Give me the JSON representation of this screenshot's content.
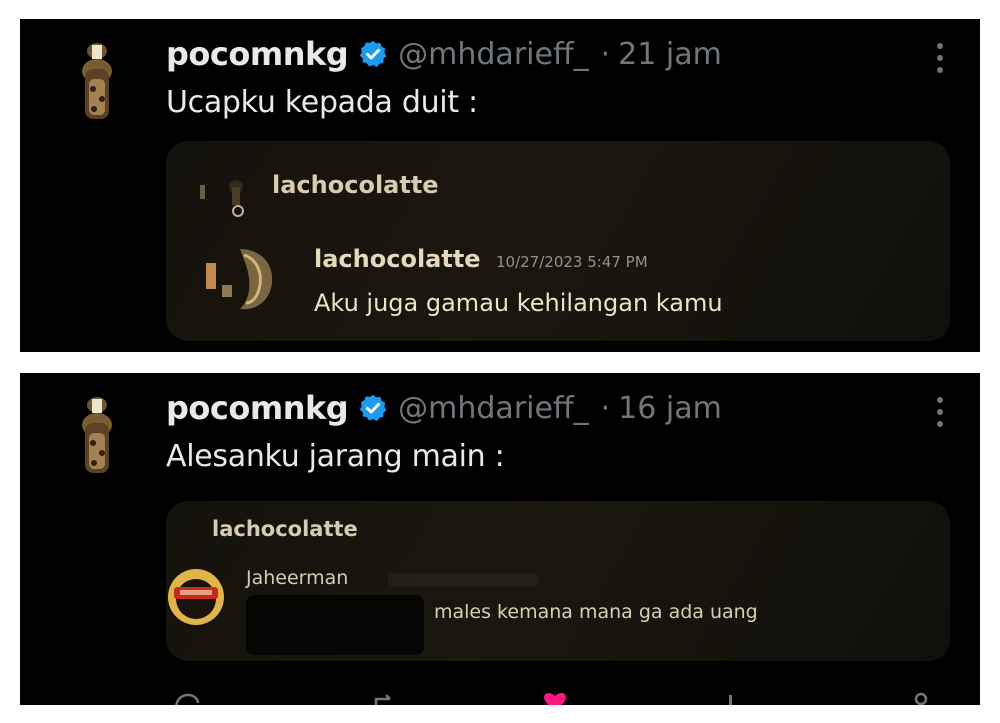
{
  "posts": [
    {
      "author_name": "pocomnkg",
      "handle": "@mhdarieff_",
      "separator": "·",
      "time": "21 jam",
      "text": "Ucapku kepada duit :",
      "quote": {
        "header_name": "lachocolatte",
        "message_author": "lachocolatte",
        "message_time": "10/27/2023 5:47 PM",
        "message_text": "Aku juga gamau kehilangan kamu"
      }
    },
    {
      "author_name": "pocomnkg",
      "handle": "@mhdarieff_",
      "separator": "·",
      "time": "16 jam",
      "text": "Alesanku jarang main :",
      "quote": {
        "header_name": "lachocolatte",
        "message_author": "Jaheerman",
        "message_text": "males kemana mana ga ada uang"
      }
    }
  ],
  "colors": {
    "verified": "#1d9bf0",
    "name": "#e7e9ea",
    "meta": "#71767b",
    "like": "#f91880"
  },
  "icons": {
    "verified": "verified-badge-icon",
    "more": "more-dots-icon",
    "reply": "reply-icon",
    "retweet": "retweet-icon",
    "like": "heart-icon",
    "views": "views-icon",
    "bookmark": "bookmark-icon"
  }
}
